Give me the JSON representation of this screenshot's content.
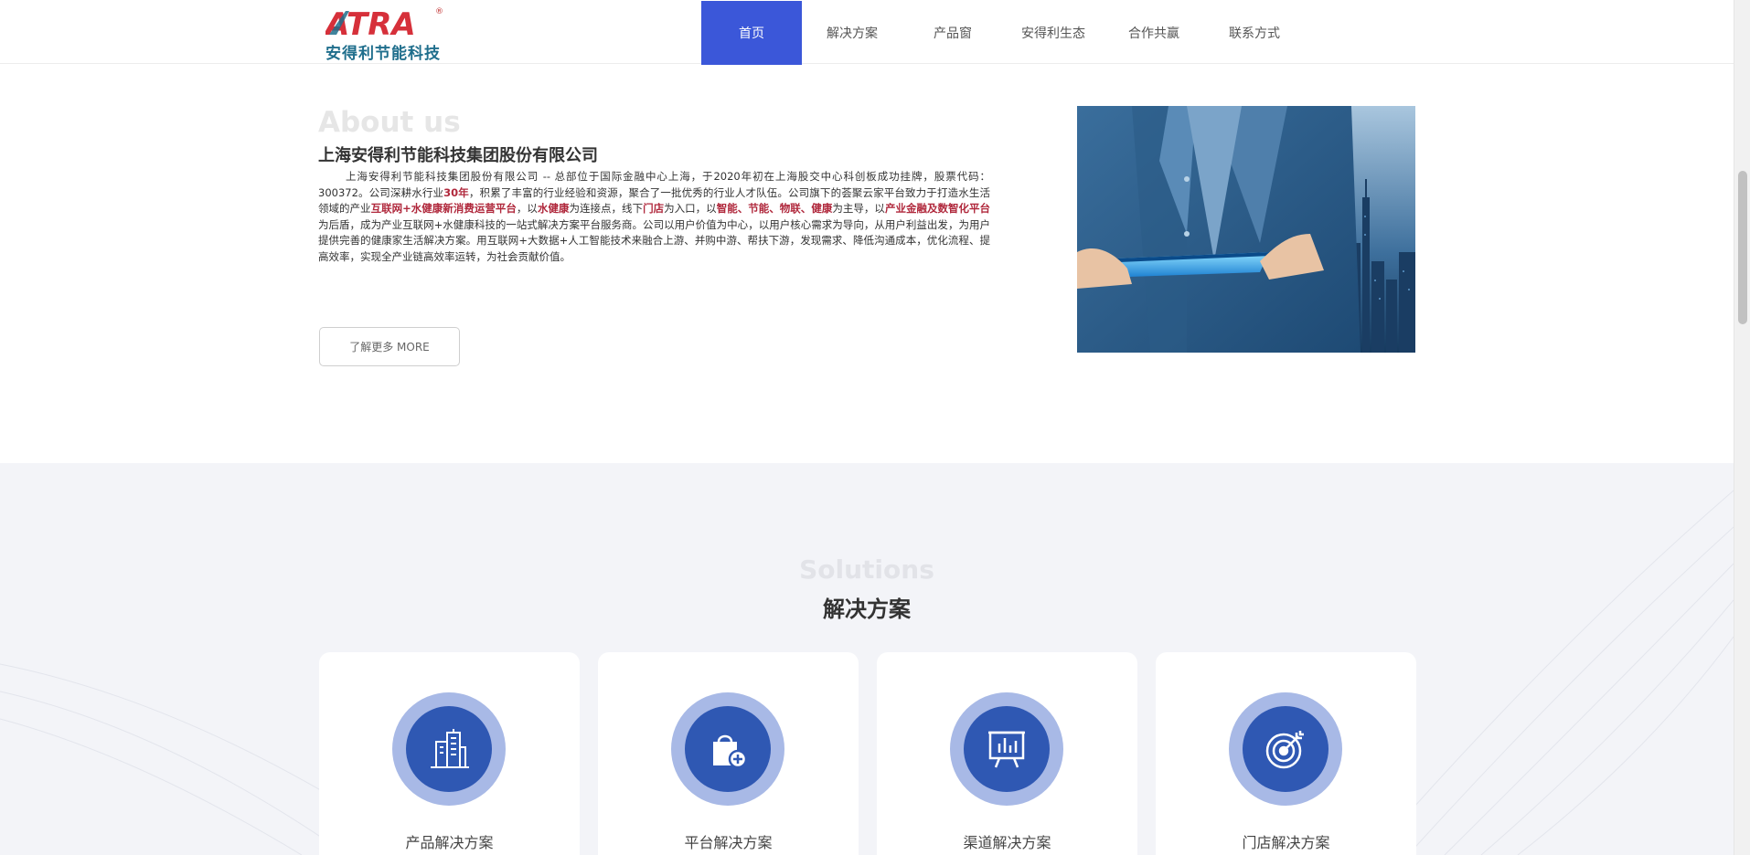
{
  "header": {
    "logo_text": "安得利节能科技",
    "logo_mark": "ATRA",
    "logo_reg": "®",
    "nav": [
      {
        "label": "首页",
        "active": true
      },
      {
        "label": "解决方案",
        "active": false
      },
      {
        "label": "产品窗",
        "active": false
      },
      {
        "label": "安得利生态",
        "active": false
      },
      {
        "label": "合作共赢",
        "active": false
      },
      {
        "label": "联系方式",
        "active": false
      }
    ]
  },
  "about": {
    "title_en": "About us",
    "title": "上海安得利节能科技集团股份有限公司",
    "desc": {
      "p1": "上海安得利节能科技集团股份有限公司 -- 总部位于国际金融中心上海，于2020年初在上海股交中心科创板成功挂牌，股票代码：300372。公司深耕水行业",
      "r1": "30年",
      "p2": "，积累了丰富的行业经验和资源，聚合了一批优秀的行业人才队伍。公司旗下的荟聚云家平台致力于打造水生活领域的产业",
      "r2": "互联网+水健康新消费运营平台",
      "p3": "，以",
      "r3": "水健康",
      "p4": "为连接点，线下",
      "r4": "门店",
      "p5": "为入口，以",
      "r5": "智能、节能、物联、健康",
      "p6": "为主导，以",
      "r6": "产业金融及数智化平台",
      "p7": "为后盾，成为产业互联网+水健康科技的一站式解决方案平台服务商。公司以用户价值为中心，以用户核心需求为导向，从用户利益出发，为用户提供完善的健康家生活解决方案。用互联网+大数据+人工智能技术来融合上游、并购中游、帮扶下游，发现需求、降低沟通成本，优化流程、提高效率，实现全产业链高效率运转，为社会贡献价值。"
    },
    "more_label": "了解更多 MORE"
  },
  "solutions": {
    "title_en": "Solutions",
    "title": "解决方案",
    "cards": [
      {
        "label": "产品解决方案",
        "icon": "building-icon"
      },
      {
        "label": "平台解决方案",
        "icon": "shopping-bag-plus-icon"
      },
      {
        "label": "渠道解决方案",
        "icon": "presentation-board-icon"
      },
      {
        "label": "门店解决方案",
        "icon": "target-icon"
      }
    ]
  },
  "colors": {
    "nav_active": "#3b57d9",
    "accent_red": "#b0283c",
    "circle_outer": "#a8b9e6",
    "circle_inner": "#2f58b3"
  }
}
